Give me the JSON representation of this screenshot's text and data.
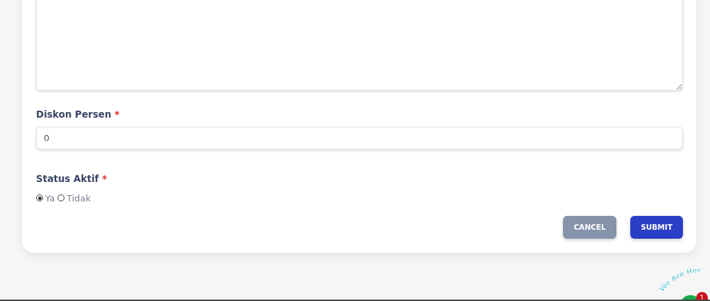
{
  "form": {
    "fields": [
      {
        "kind": "textarea"
      },
      {
        "kind": "input",
        "label": "Diskon Persen",
        "required_mark": "*",
        "value": "0"
      },
      {
        "kind": "radio",
        "label": "Status Aktif",
        "required_mark": "*",
        "options": [
          {
            "label": "Ya",
            "selected": true
          },
          {
            "label": "Tidak",
            "selected": false
          }
        ]
      }
    ],
    "buttons": [
      {
        "label": "CANCEL",
        "kind": "secondary"
      },
      {
        "label": "SUBMIT",
        "kind": "primary"
      }
    ]
  },
  "chat_widget": {
    "caption": "We Are Her",
    "badge": "1"
  }
}
